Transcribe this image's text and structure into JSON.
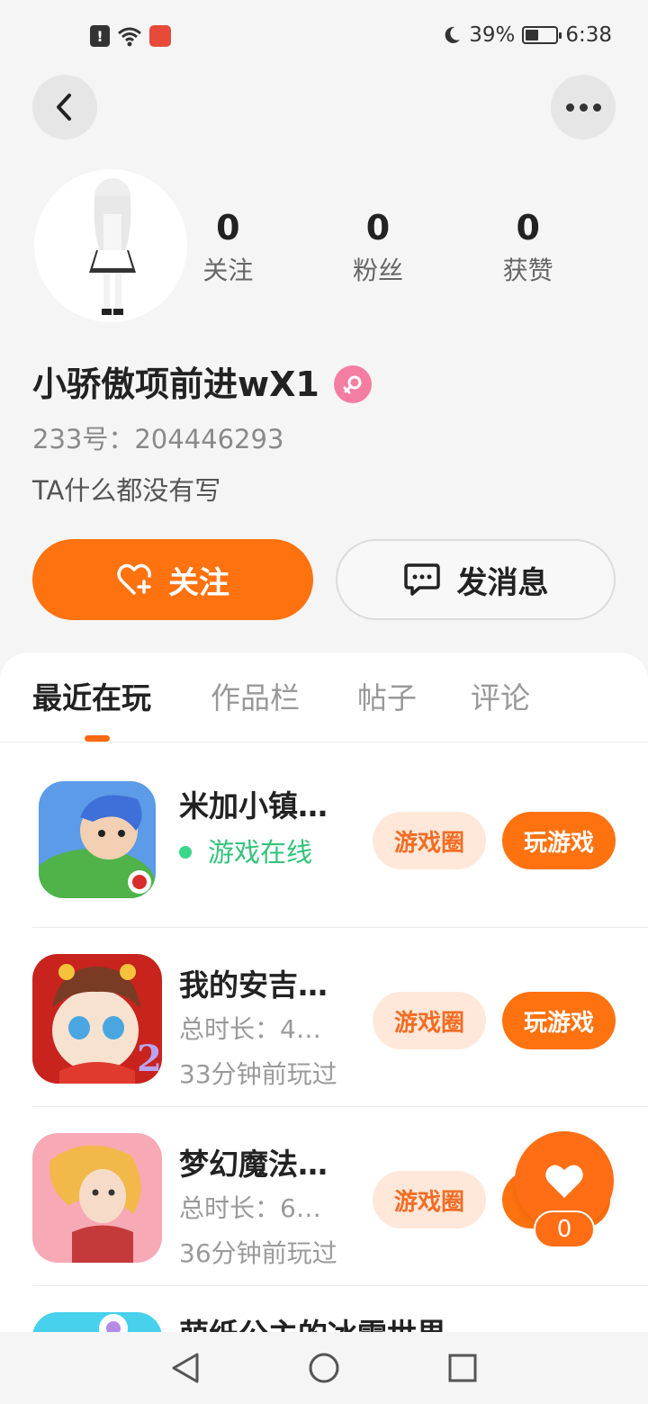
{
  "status_bar": {
    "alert_glyph": "!",
    "battery": "39%",
    "time": "6:38"
  },
  "profile": {
    "stats": [
      {
        "value": "0",
        "label": "关注"
      },
      {
        "value": "0",
        "label": "粉丝"
      },
      {
        "value": "0",
        "label": "获赞"
      }
    ],
    "username": "小骄傲项前进wX1",
    "id_text": "233号：204446293",
    "bio": "TA什么都没有写",
    "follow_label": "关注",
    "message_label": "发消息"
  },
  "tabs": [
    {
      "label": "最近在玩",
      "active": true
    },
    {
      "label": "作品栏",
      "active": false
    },
    {
      "label": "帖子",
      "active": false
    },
    {
      "label": "评论",
      "active": false
    }
  ],
  "games": [
    {
      "title": "米加小镇…",
      "status": "游戏在线",
      "circle_label": "游戏圈",
      "play_label": "玩游戏"
    },
    {
      "title": "我的安吉…",
      "duration": "总时长：4…",
      "last_played": "33分钟前玩过",
      "circle_label": "游戏圈",
      "play_label": "玩游戏"
    },
    {
      "title": "梦幻魔法…",
      "duration": "总时长：6…",
      "last_played": "36分钟前玩过",
      "circle_label": "游戏圈"
    },
    {
      "title": "萌纸公主的冰雪世界"
    }
  ],
  "like": {
    "count": "0"
  },
  "colors": {
    "accent": "#ff7210",
    "online": "#33c37a",
    "gender": "#f47ea1"
  }
}
